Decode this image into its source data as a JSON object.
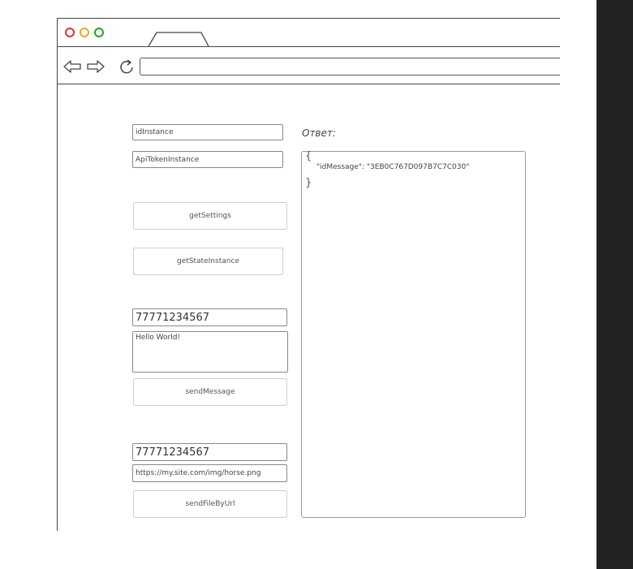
{
  "browser": {
    "window_buttons": [
      {
        "name": "close",
        "color": "#e0332c"
      },
      {
        "name": "minimize",
        "color": "#e6a91e"
      },
      {
        "name": "maximize",
        "color": "#1fa320"
      }
    ]
  },
  "form": {
    "id_instance_placeholder": "idInstance",
    "api_token_placeholder": "ApiTokenInstance",
    "get_settings_label": "getSettings",
    "get_state_label": "getStateInstance",
    "message_phone_value": "77771234567",
    "message_text_value": "Hello World!",
    "send_message_label": "sendMessage",
    "file_phone_value": "77771234567",
    "file_url_value": "https://my.site.com/img/horse.png",
    "send_file_label": "sendFileByUrl"
  },
  "output": {
    "label": "Ответ:",
    "open_brace": "{",
    "json_text": "\"idMessage\": \"3EB0C767D097B7C7C030\"",
    "close_brace": "}"
  }
}
